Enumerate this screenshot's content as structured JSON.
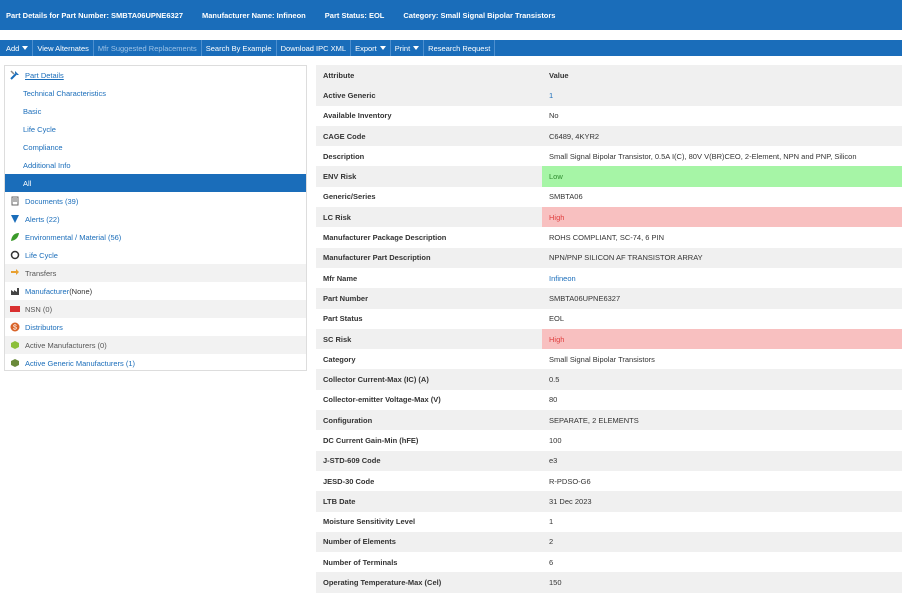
{
  "titlebar": {
    "part": "Part Details for Part Number: SMBTA06UPNE6327",
    "manufacturer": "Manufacturer Name: Infineon",
    "status": "Part Status: EOL",
    "category": "Category: Small Signal Bipolar Transistors"
  },
  "toolbar": {
    "add": "Add",
    "view_alternates": "View Alternates",
    "mfr_suggested": "Mfr Suggested Replacements",
    "search_example": "Search By Example",
    "download_ipc": "Download IPC XML",
    "export": "Export",
    "print": "Print",
    "research": "Research Request"
  },
  "sidebar": {
    "part_details": "Part Details",
    "technical": "Technical Characteristics",
    "basic": "Basic",
    "life_cycle_sub": "Life Cycle",
    "compliance": "Compliance",
    "additional": "Additional Info",
    "all": "All",
    "documents": "Documents (39)",
    "alerts": "Alerts (22)",
    "environmental": "Environmental / Material (56)",
    "life_cycle": "Life Cycle",
    "transfers": "Transfers",
    "manufacturer_label": "Manufacturer",
    "manufacturer_value": " (None)",
    "nsn": "NSN (0)",
    "distributors": "Distributors",
    "active_mfrs": "Active Manufacturers (0)",
    "active_generic_mfrs": "Active Generic Manufacturers (1)"
  },
  "table": {
    "header_attr": "Attribute",
    "header_value": "Value",
    "rows": [
      {
        "a": "Active Generic",
        "v": "1"
      },
      {
        "a": "Available Inventory",
        "v": "No"
      },
      {
        "a": "CAGE Code",
        "v": "C6489, 4KYR2"
      },
      {
        "a": "Description",
        "v": "Small Signal Bipolar Transistor, 0.5A I(C), 80V V(BR)CEO, 2-Element, NPN and PNP, Silicon"
      },
      {
        "a": "ENV Risk",
        "v": "Low"
      },
      {
        "a": "Generic/Series",
        "v": "SMBTA06"
      },
      {
        "a": "LC Risk",
        "v": "High"
      },
      {
        "a": "Manufacturer Package Description",
        "v": "ROHS COMPLIANT, SC-74, 6 PIN"
      },
      {
        "a": "Manufacturer Part Description",
        "v": "NPN/PNP SILICON AF TRANSISTOR ARRAY"
      },
      {
        "a": "Mfr Name",
        "v": "Infineon"
      },
      {
        "a": "Part Number",
        "v": "SMBTA06UPNE6327"
      },
      {
        "a": "Part Status",
        "v": "EOL"
      },
      {
        "a": "SC Risk",
        "v": "High"
      },
      {
        "a": "Category",
        "v": "Small Signal Bipolar Transistors"
      },
      {
        "a": "Collector Current-Max (IC) (A)",
        "v": "0.5"
      },
      {
        "a": "Collector-emitter Voltage-Max (V)",
        "v": "80"
      },
      {
        "a": "Configuration",
        "v": "SEPARATE, 2 ELEMENTS"
      },
      {
        "a": "DC Current Gain-Min (hFE)",
        "v": "100"
      },
      {
        "a": "J-STD-609 Code",
        "v": "e3"
      },
      {
        "a": "JESD-30 Code",
        "v": "R-PDSO-G6"
      },
      {
        "a": "LTB Date",
        "v": "31 Dec 2023"
      },
      {
        "a": "Moisture Sensitivity Level",
        "v": "1"
      },
      {
        "a": "Number of Elements",
        "v": "2"
      },
      {
        "a": "Number of Terminals",
        "v": "6"
      },
      {
        "a": "Operating Temperature-Max (Cel)",
        "v": "150"
      }
    ]
  },
  "colors": {
    "accent": "#1a6dba",
    "low": "#a6f5a6",
    "high": "#f8c0c0"
  },
  "icons": [
    "tools-icon",
    "documents-icon",
    "alert-icon",
    "leaf-icon",
    "lifecycle-icon",
    "transfer-icon",
    "factory-icon",
    "nsn-icon",
    "dollar-icon",
    "cube-icon"
  ]
}
